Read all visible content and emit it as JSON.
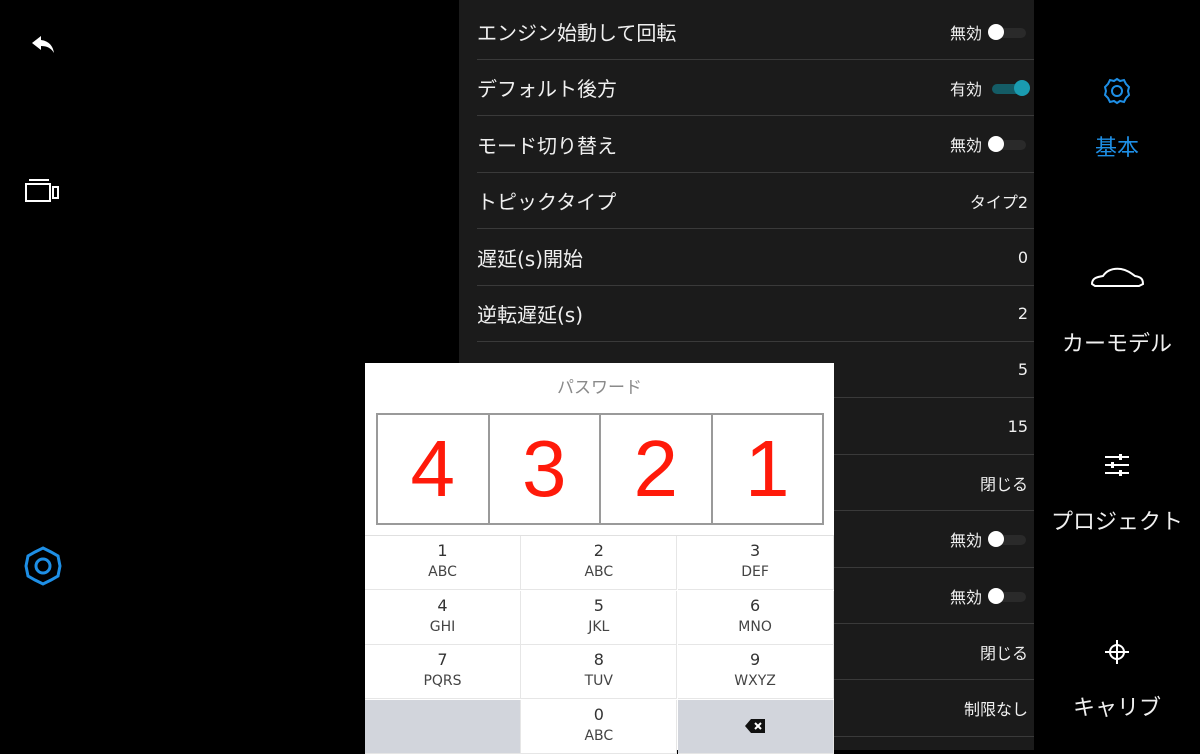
{
  "settings": [
    {
      "label": "エンジン始動して回転",
      "value": "無効",
      "toggle": "off"
    },
    {
      "label": "デフォルト後方",
      "value": "有効",
      "toggle": "on"
    },
    {
      "label": "モード切り替え",
      "value": "無効",
      "toggle": "off"
    },
    {
      "label": "トピックタイプ",
      "value": "タイプ2"
    },
    {
      "label": "遅延(s)開始",
      "value": "0"
    },
    {
      "label": "逆転遅延(s)",
      "value": "2"
    },
    {
      "label": "",
      "value": "5"
    },
    {
      "label": "",
      "value": "15"
    },
    {
      "label": "",
      "value": "閉じる"
    },
    {
      "label": "",
      "value": "無効",
      "toggle": "off"
    },
    {
      "label": "",
      "value": "無効",
      "toggle": "off"
    },
    {
      "label": "",
      "value": "閉じる"
    },
    {
      "label": "",
      "value": "制限なし"
    }
  ],
  "right_nav": [
    {
      "label": "基本",
      "icon": "gear-icon",
      "active": true
    },
    {
      "label": "カーモデル",
      "icon": "car-icon",
      "active": false
    },
    {
      "label": "プロジェクト",
      "icon": "sliders-icon",
      "active": false
    },
    {
      "label": "キャリブ",
      "icon": "crosshair-icon",
      "active": false
    }
  ],
  "left_nav": [
    {
      "icon": "back-arrow-icon"
    },
    {
      "icon": "camera-video-icon"
    },
    {
      "icon": "settings-gear-icon"
    }
  ],
  "password_dialog": {
    "title": "パスワード",
    "digits": [
      "4",
      "3",
      "2",
      "1"
    ],
    "keys": [
      {
        "n": "1",
        "l": "ABC"
      },
      {
        "n": "2",
        "l": "ABC"
      },
      {
        "n": "3",
        "l": "DEF"
      },
      {
        "n": "4",
        "l": "GHI"
      },
      {
        "n": "5",
        "l": "JKL"
      },
      {
        "n": "6",
        "l": "MNO"
      },
      {
        "n": "7",
        "l": "PQRS"
      },
      {
        "n": "8",
        "l": "TUV"
      },
      {
        "n": "9",
        "l": "WXYZ"
      },
      {
        "n": "",
        "l": ""
      },
      {
        "n": "0",
        "l": "ABC"
      },
      {
        "n": "",
        "l": "",
        "icon": "backspace-icon"
      }
    ]
  },
  "colors": {
    "accent": "#1e8fe6",
    "toggle_on": "#1a9bb0",
    "pin_digit": "#ff1a0a"
  }
}
